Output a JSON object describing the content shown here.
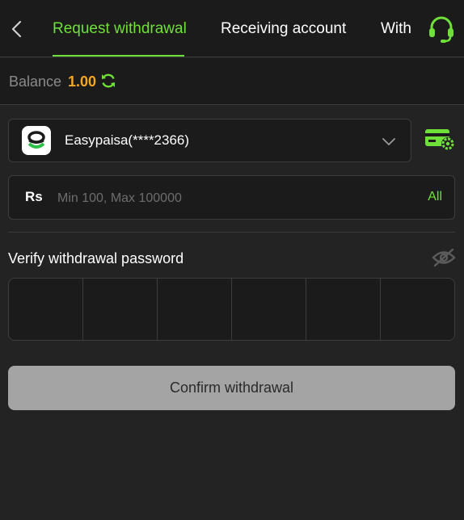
{
  "header": {
    "tabs": [
      {
        "label": "Request withdrawal",
        "active": true
      },
      {
        "label": "Receiving account",
        "active": false
      },
      {
        "label": "With",
        "active": false
      }
    ],
    "back_icon": "chevron-left-icon",
    "support_icon": "headset-icon"
  },
  "balance": {
    "label": "Balance",
    "value": "1.00",
    "refresh_icon": "refresh-icon"
  },
  "account": {
    "name": "Easypaisa(****2366)",
    "logo": "easypaisa-logo",
    "dropdown_icon": "chevron-down-icon",
    "manage_icon": "card-settings-icon"
  },
  "amount": {
    "currency": "Rs",
    "placeholder": "Min 100, Max 100000",
    "value": "",
    "all_label": "All"
  },
  "password": {
    "label": "Verify withdrawal password",
    "visibility_icon": "eye-off-icon",
    "length": 6
  },
  "confirm_label": "Confirm withdrawal",
  "colors": {
    "accent": "#6fe03a",
    "balance": "#f5a623",
    "background": "#232323",
    "panel": "#1b1b1b",
    "button_disabled": "#a4a4a4"
  }
}
